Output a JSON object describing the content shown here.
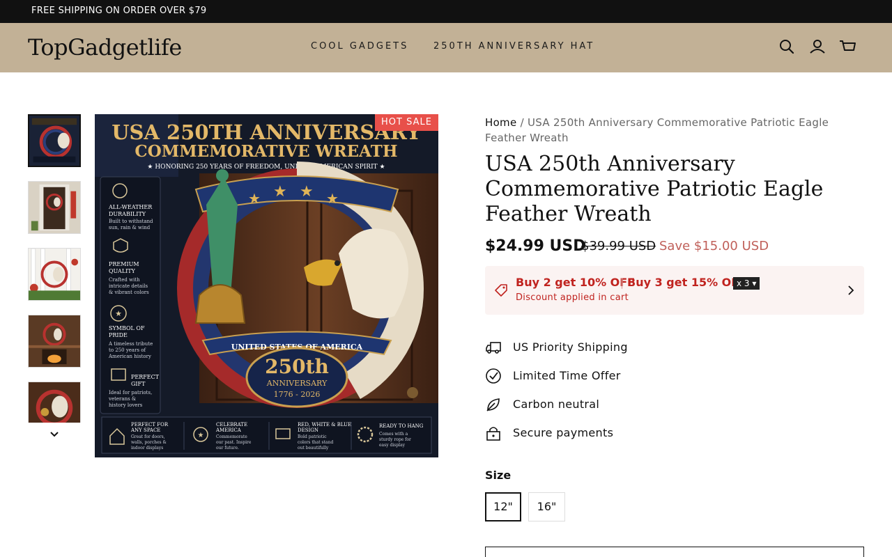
{
  "announcement": {
    "text": "FREE SHIPPING ON ORDER OVER $79"
  },
  "header": {
    "logo": "TopGadgetlife",
    "nav": [
      "COOL GADGETS",
      "250TH ANNIVERSARY HAT"
    ],
    "icons": [
      "search-icon",
      "account-icon",
      "cart-icon"
    ],
    "background": "#c2b196"
  },
  "gallery": {
    "badge": "HOT SALE",
    "thumbnails": 5,
    "image_text": {
      "headline1": "USA 250TH ANNIVERSARY",
      "headline2": "COMMEMORATIVE WREATH",
      "tagline": "★ HONORING 250 YEARS OF FREEDOM, UNITY & AMERICAN SPIRIT ★",
      "features": [
        {
          "title1": "ALL-WEATHER",
          "title2": "DURABILITY",
          "desc": [
            "Built to withstand",
            "sun, rain & wind"
          ]
        },
        {
          "title1": "PREMIUM",
          "title2": "QUALITY",
          "desc": [
            "Crafted with",
            "intricate details",
            "& vibrant colors"
          ]
        },
        {
          "title1": "SYMBOL OF",
          "title2": "PRIDE",
          "desc": [
            "A timeless tribute",
            "to 250 years of",
            "American history"
          ]
        },
        {
          "title1": "PERFECT",
          "title2": "GIFT",
          "desc": [
            "Ideal for patriots,",
            "veterans &",
            "history lovers"
          ]
        }
      ],
      "banner": "UNITED STATES OF AMERICA",
      "big": "250th",
      "anniversary": "ANNIVERSARY",
      "years": "1776 - 2026",
      "bottom": [
        {
          "title": [
            "PERFECT FOR",
            "ANY SPACE"
          ],
          "desc": [
            "Great for doors,",
            "walls, porches &",
            "indoor displays"
          ]
        },
        {
          "title": [
            "CELEBRATE",
            "AMERICA"
          ],
          "desc": [
            "Commemorate",
            "our past. Inspire",
            "our future."
          ]
        },
        {
          "title": [
            "RED, WHITE & BLUE",
            "DESIGN"
          ],
          "desc": [
            "Bold patriotic",
            "colors that stand",
            "out beautifully"
          ]
        },
        {
          "title": [
            "READY TO HANG"
          ],
          "desc": [
            "Comes with a",
            "sturdy rope for",
            "easy display"
          ]
        }
      ]
    }
  },
  "breadcrumb": {
    "home": "Home",
    "separator": " / ",
    "current": "USA 250th Anniversary Commemorative Patriotic Eagle Feather Wreath"
  },
  "product": {
    "title": "USA 250th Anniversary Commemorative Patriotic Eagle Feather Wreath",
    "price": "$24.99 USD",
    "compare_price": "$39.99 USD",
    "save": "Save $15.00 USD"
  },
  "discount": {
    "offer1": "Buy 2 get 10% OFF",
    "separator": "|",
    "offer2": "Buy 3 get 15% OFF",
    "qty": "x 3 ▾",
    "note": "Discount applied in cart"
  },
  "features": [
    "US Priority Shipping",
    "Limited Time Offer",
    "Carbon neutral",
    "Secure payments"
  ],
  "size": {
    "label": "Size",
    "options": [
      "12\"",
      "16\""
    ],
    "selected": "12\""
  },
  "colors": {
    "sale_red": "#c0231f",
    "badge": "#e8504a",
    "save": "#c0605a"
  }
}
